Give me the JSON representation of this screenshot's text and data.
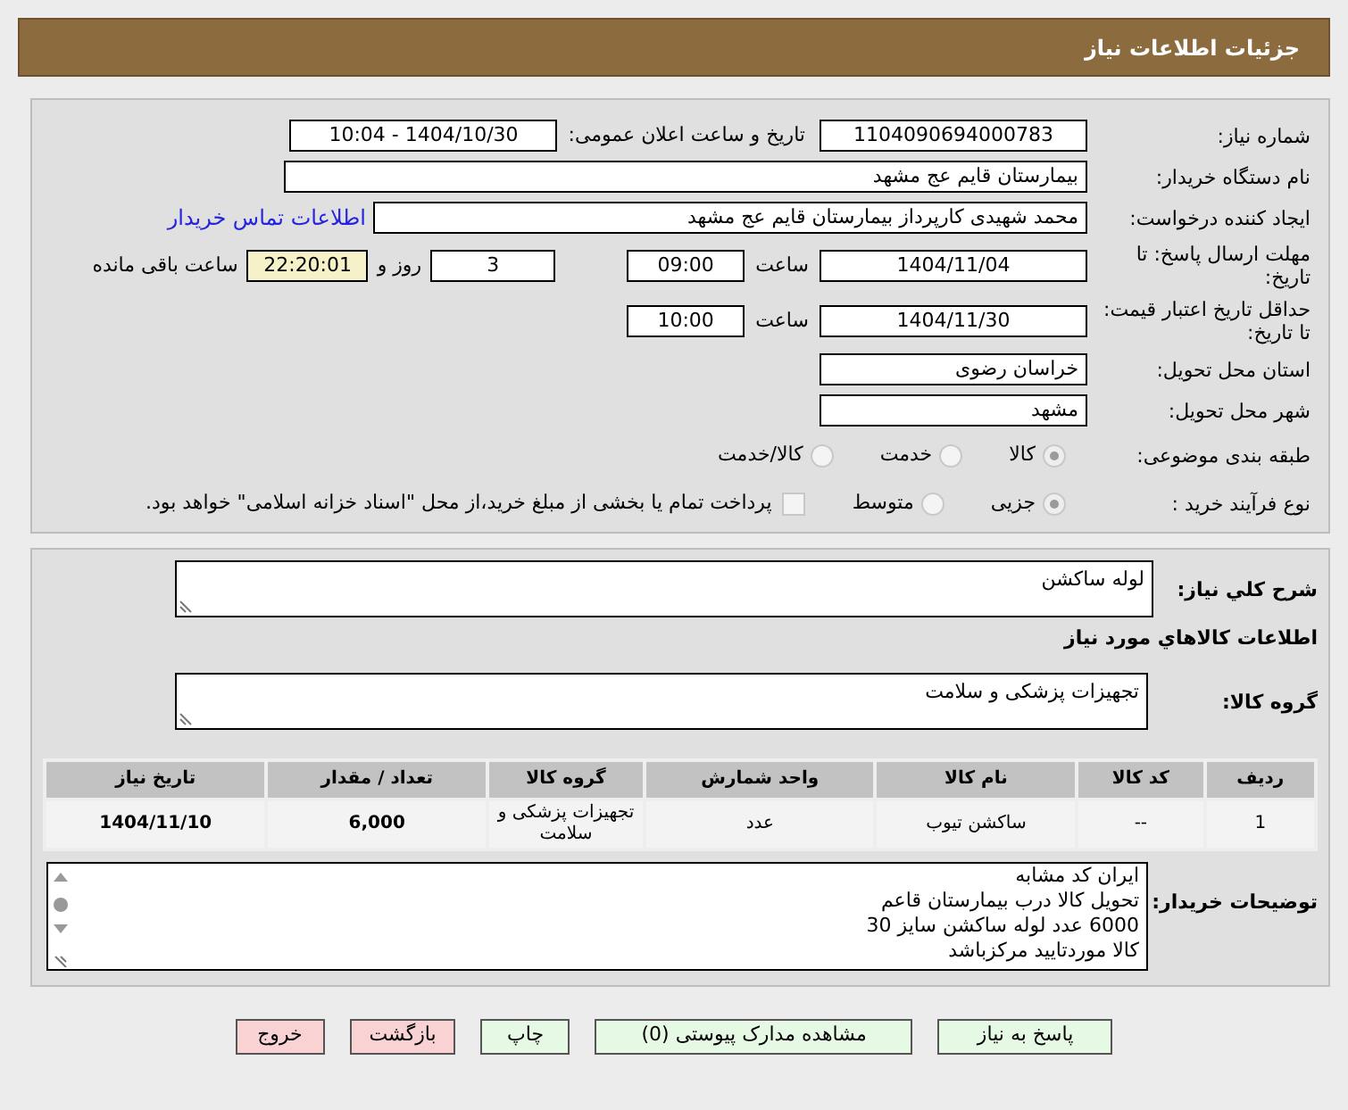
{
  "header": {
    "title": "جزئیات اطلاعات نیاز"
  },
  "need_number": {
    "label": "شماره نیاز:",
    "value": "1104090694000783"
  },
  "announce": {
    "label": "تاریخ و ساعت اعلان عمومی:",
    "value": "1404/10/30 - 10:04"
  },
  "buyer_org": {
    "label": "نام دستگاه خریدار:",
    "value": "بیمارستان قایم  عج  مشهد"
  },
  "requester": {
    "label": "ایجاد کننده درخواست:",
    "value": "محمد شهیدی کارپرداز بیمارستان قایم  عج  مشهد",
    "link": "اطلاعات تماس خریدار"
  },
  "deadline": {
    "label": "مهلت ارسال پاسخ: تا تاریخ:",
    "date": "1404/11/04",
    "time_label": "ساعت",
    "time": "09:00",
    "days": "3",
    "days_label": "روز و",
    "remaining": "22:20:01",
    "remaining_label": "ساعت باقی مانده"
  },
  "validity": {
    "label": "حداقل تاریخ اعتبار قیمت: تا تاریخ:",
    "date": "1404/11/30",
    "time_label": "ساعت",
    "time": "10:00"
  },
  "province": {
    "label": "استان محل تحویل:",
    "value": "خراسان رضوی"
  },
  "city": {
    "label": "شهر محل تحویل:",
    "value": "مشهد"
  },
  "category": {
    "label": "طبقه بندی موضوعی:",
    "options": [
      {
        "label": "کالا",
        "selected": true
      },
      {
        "label": "خدمت",
        "selected": false
      },
      {
        "label": "کالا/خدمت",
        "selected": false
      }
    ]
  },
  "process": {
    "label": "نوع فرآیند خرید :",
    "options": [
      {
        "label": "جزیی",
        "selected": true
      },
      {
        "label": "متوسط",
        "selected": false
      }
    ],
    "treasury": {
      "checked": false,
      "label": "پرداخت تمام یا بخشی از مبلغ خرید،از محل \"اسناد خزانه اسلامی\" خواهد بود."
    }
  },
  "summary": {
    "label": "شرح کلي نياز:",
    "value": "لوله ساکشن"
  },
  "items_heading": "اطلاعات کالاهاي مورد نياز",
  "goods_group": {
    "label": "گروه کالا:",
    "value": "تجهیزات پزشکی و سلامت"
  },
  "table": {
    "columns": [
      "ردیف",
      "کد کالا",
      "نام کالا",
      "واحد شمارش",
      "گروه کالا",
      "تعداد / مقدار",
      "تاریخ نیاز"
    ],
    "rows": [
      [
        "1",
        "--",
        "ساکشن تیوب",
        "عدد",
        "تجهیزات پزشکی و سلامت",
        "6,000",
        "1404/11/10"
      ]
    ]
  },
  "notes": {
    "label": "توضیحات خریدار:",
    "lines": [
      "ایران کد مشابه",
      "تحویل کالا درب بیمارستان قاعم",
      "6000 عدد  لوله ساکشن سایز 30",
      "کالا موردتایید مرکزباشد"
    ]
  },
  "buttons": [
    {
      "label": "پاسخ به نیاز",
      "kind": "normal"
    },
    {
      "label": "مشاهده مدارک پیوستی (0)",
      "kind": "normal"
    },
    {
      "label": "چاپ",
      "kind": "normal"
    },
    {
      "label": "بازگشت",
      "kind": "danger"
    },
    {
      "label": "خروج",
      "kind": "danger"
    }
  ]
}
